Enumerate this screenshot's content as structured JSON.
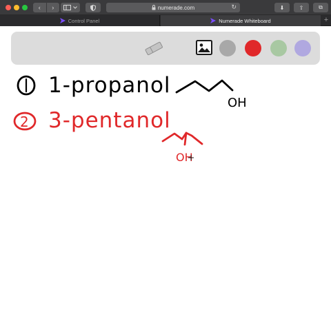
{
  "browser": {
    "nav_back": "‹",
    "nav_forward": "›",
    "url": "numerade.com",
    "reload": "↻",
    "download": "⬇",
    "share": "⇧",
    "tabs_overview": "⧉",
    "new_tab": "+"
  },
  "tabs": [
    {
      "label": "Control Panel",
      "active": false
    },
    {
      "label": "Numerade Whiteboard",
      "active": true
    }
  ],
  "toolbar": {
    "tools": [
      "eraser-icon",
      "image-icon"
    ],
    "colors": [
      "#a8a8a8",
      "#e0282a",
      "#a8c8a2",
      "#b0a8e0"
    ],
    "selected_color": "#000000"
  },
  "annotations": [
    {
      "number": "1",
      "text": "1-propanol",
      "label": "OH",
      "color": "#000000"
    },
    {
      "number": "2",
      "text": "3-pentanol",
      "label": "OH",
      "color": "#e0282a"
    }
  ]
}
